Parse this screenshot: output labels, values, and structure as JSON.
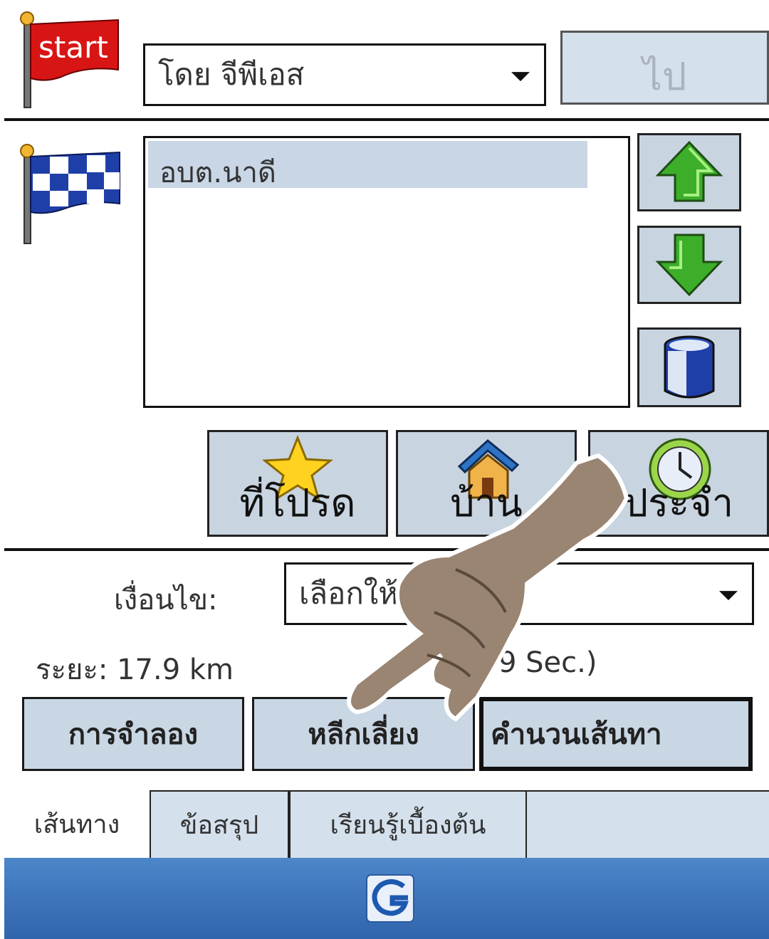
{
  "start_section": {
    "flag_text": "start",
    "source_select_value": "โดย จีพีเอส",
    "go_button_label": "ไป"
  },
  "destinations": {
    "items": [
      "อบต.นาดี"
    ]
  },
  "quick_buttons": {
    "favorite_label": "ที่โปรด",
    "home_label": "บ้าน",
    "regular_label": "ประจำ"
  },
  "conditions": {
    "label": "เงื่อนไข:",
    "select_value": "เลือกให้ทาง...",
    "distance_text": "ระยะ: 17.9 km",
    "time_text": "9 Sec.)"
  },
  "actions": {
    "simulate_label": "การจำลอง",
    "avoid_label": "หลีกเลี่ยง",
    "calculate_label": "คำนวนเส้นทา"
  },
  "tabs": {
    "route": "เส้นทาง",
    "summary": "ข้อสรุป",
    "tutorial": "เรียนรู้เบื้องต้น"
  },
  "colors": {
    "button_bg": "#c9d6e3",
    "taskbar": "#3a72b8",
    "arrow_green": "#34a51f",
    "flag_red": "#d81515",
    "flag_blue": "#1f3fa8"
  }
}
